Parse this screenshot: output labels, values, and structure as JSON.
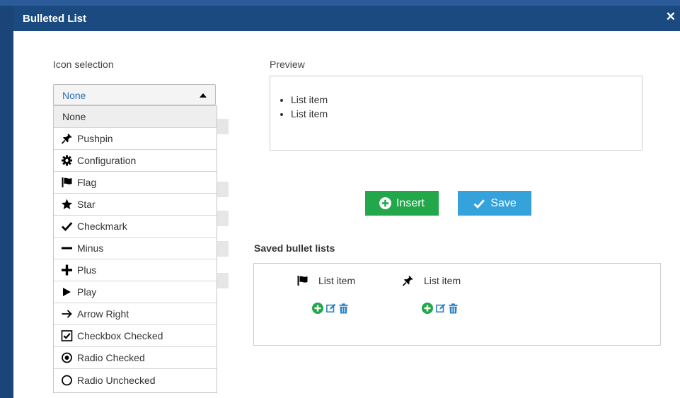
{
  "dialog": {
    "title": "Bulleted List",
    "close_glyph": "✕"
  },
  "icon_selection": {
    "label": "Icon selection",
    "selected": "None",
    "options": [
      {
        "label": "None",
        "icon": ""
      },
      {
        "label": "Pushpin",
        "icon": "pushpin-icon"
      },
      {
        "label": "Configuration",
        "icon": "gear-icon"
      },
      {
        "label": "Flag",
        "icon": "flag-icon"
      },
      {
        "label": "Star",
        "icon": "star-icon"
      },
      {
        "label": "Checkmark",
        "icon": "checkmark-icon"
      },
      {
        "label": "Minus",
        "icon": "minus-icon"
      },
      {
        "label": "Plus",
        "icon": "plus-icon"
      },
      {
        "label": "Play",
        "icon": "play-icon"
      },
      {
        "label": "Arrow Right",
        "icon": "arrow-right-icon"
      },
      {
        "label": "Checkbox Checked",
        "icon": "checkbox-checked-icon"
      },
      {
        "label": "Radio Checked",
        "icon": "radio-checked-icon"
      },
      {
        "label": "Radio Unchecked",
        "icon": "radio-unchecked-icon"
      }
    ]
  },
  "preview": {
    "label": "Preview",
    "items": [
      "List item",
      "List item"
    ]
  },
  "buttons": {
    "insert": "Insert",
    "save": "Save"
  },
  "saved_lists": {
    "title": "Saved bullet lists",
    "items": [
      {
        "icon": "flag-icon",
        "label": "List item"
      },
      {
        "icon": "pushpin-icon",
        "label": "List item"
      }
    ]
  },
  "colors": {
    "titlebar": "#1b4a80",
    "insert": "#22a74a",
    "save": "#35a2dc",
    "add_action": "#22a74a",
    "edit_action": "#2a7fc4",
    "delete_action": "#2a7fc4",
    "selected_text": "#2a6fb5"
  }
}
